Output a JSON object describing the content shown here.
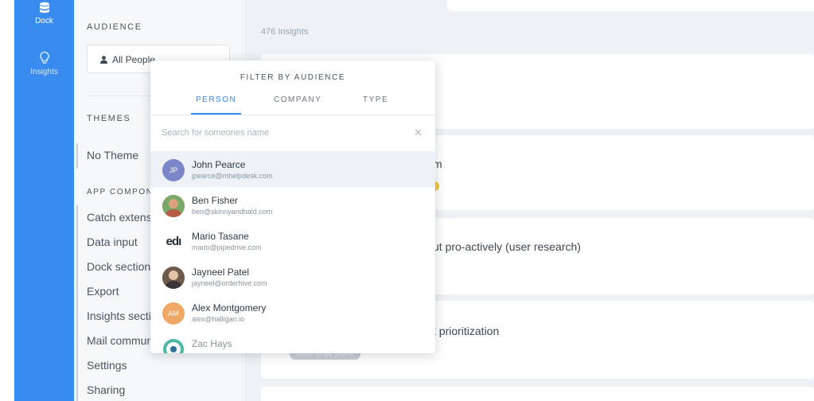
{
  "rail": {
    "items": [
      {
        "label": "Dock",
        "icon": "database-icon"
      },
      {
        "label": "Insights",
        "icon": "lightbulb-icon"
      }
    ]
  },
  "sidebar": {
    "audience_title": "AUDIENCE",
    "audience_value": "All People",
    "themes_title": "THEMES",
    "theme_item": "No Theme",
    "components_title": "APP COMPONENTS",
    "components": [
      "Catch extension",
      "Data input",
      "Dock sections",
      "Export",
      "Insights sections",
      "Mail communication",
      "Settings",
      "Sharing"
    ]
  },
  "main": {
    "insight_count": "476 Insights",
    "cards": [
      {
        "text": "m"
      },
      {
        "text": "ut pro-actively (user research)"
      },
      {
        "text": "t prioritization",
        "badge": "Jobs to be Done"
      }
    ]
  },
  "popover": {
    "title": "FILTER BY AUDIENCE",
    "tabs": [
      "PERSON",
      "COMPANY",
      "TYPE"
    ],
    "search_placeholder": "Search for someones name",
    "clear_icon": "close-icon",
    "people": [
      {
        "name": "John Pearce",
        "email": "jpearce@mhelpdesk.com",
        "initials": "JP",
        "color": "#7b86c9"
      },
      {
        "name": "Ben Fisher",
        "email": "ben@skinnyandbald.com",
        "initials": "",
        "color": "#c07a5a"
      },
      {
        "name": "Mario Tasane",
        "email": "mario@pipedrive.com",
        "initials": "edı",
        "color": "#ffffff"
      },
      {
        "name": "Jayneel Patel",
        "email": "jayneel@orderhive.com",
        "initials": "",
        "color": "#9a6b55"
      },
      {
        "name": "Alex Montgomery",
        "email": "alex@halligan.io",
        "initials": "AM",
        "color": "#f0a868"
      },
      {
        "name": "Zac Hays",
        "email": "",
        "initials": "",
        "color": "#ffffff"
      }
    ]
  },
  "colors": {
    "accent": "#3a8bef",
    "rail": "#3a8bef",
    "main_bg": "#eef1f5"
  }
}
